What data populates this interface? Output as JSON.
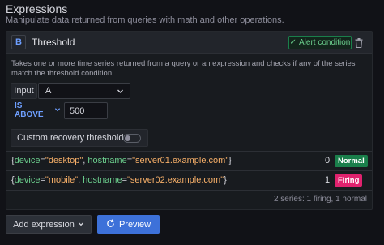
{
  "section": {
    "title": "Expressions",
    "description": "Manipulate data returned from queries with math and other operations."
  },
  "expression": {
    "ref_id": "B",
    "title": "Threshold",
    "alert_condition_label": "Alert condition",
    "help_text": "Takes one or more time series returned from a query or an expression and checks if any of the series match the threshold condition.",
    "input_label": "Input",
    "input_value": "A",
    "operator": "IS ABOVE",
    "threshold_value": "500",
    "recovery_label": "Custom recovery threshold",
    "recovery_enabled": false
  },
  "results": {
    "rows": [
      {
        "labels": [
          {
            "key": "device",
            "value": "\"desktop\""
          },
          {
            "key": "hostname",
            "value": "\"server01.example.com\""
          }
        ],
        "value": "0",
        "state": "Normal"
      },
      {
        "labels": [
          {
            "key": "device",
            "value": "\"mobile\""
          },
          {
            "key": "hostname",
            "value": "\"server02.example.com\""
          }
        ],
        "value": "1",
        "state": "Firing"
      }
    ],
    "summary": "2 series: 1 firing, 1 normal"
  },
  "actions": {
    "add_expression_label": "Add expression",
    "preview_label": "Preview"
  },
  "colors": {
    "accent": "#3d71d9",
    "normal": "#1a7f4b",
    "firing": "#e0226e",
    "label_key": "#6ccf8e",
    "label_value": "#f8b069"
  }
}
